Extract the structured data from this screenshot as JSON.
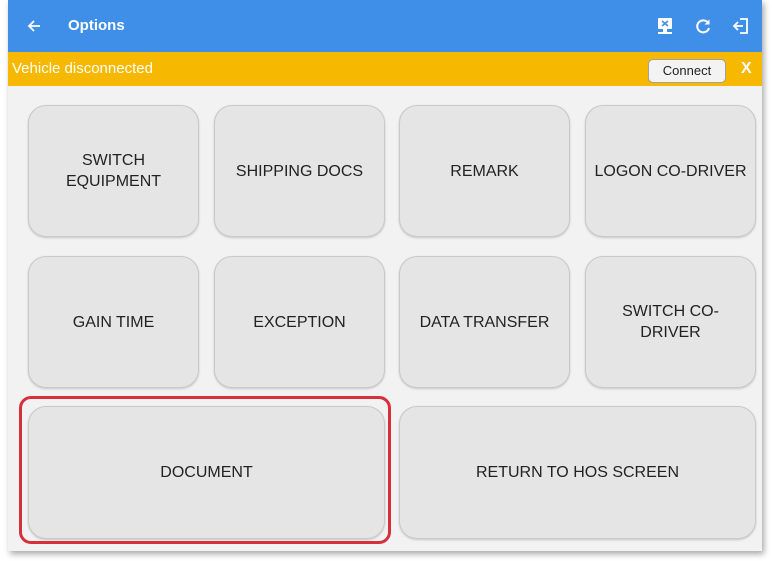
{
  "app_bar": {
    "title": "Options",
    "back_icon": "arrow-left-icon",
    "icons": [
      "device-disconnect-icon",
      "refresh-icon",
      "logout-icon"
    ],
    "color": "#3f8fe9"
  },
  "banner": {
    "message": "Vehicle disconnected",
    "connect_label": "Connect",
    "close_label": "X",
    "color": "#f6b800"
  },
  "options": [
    {
      "label": "SWITCH\nEQUIPMENT"
    },
    {
      "label": "SHIPPING DOCS"
    },
    {
      "label": "REMARK"
    },
    {
      "label": "LOGON CO-DRIVER"
    },
    {
      "label": "GAIN TIME"
    },
    {
      "label": "EXCEPTION"
    },
    {
      "label": "DATA TRANSFER"
    },
    {
      "label": "SWITCH CO-\nDRIVER"
    },
    {
      "label": "DOCUMENT"
    },
    {
      "label": "RETURN TO HOS SCREEN"
    }
  ],
  "highlight_color": "#d6303c"
}
